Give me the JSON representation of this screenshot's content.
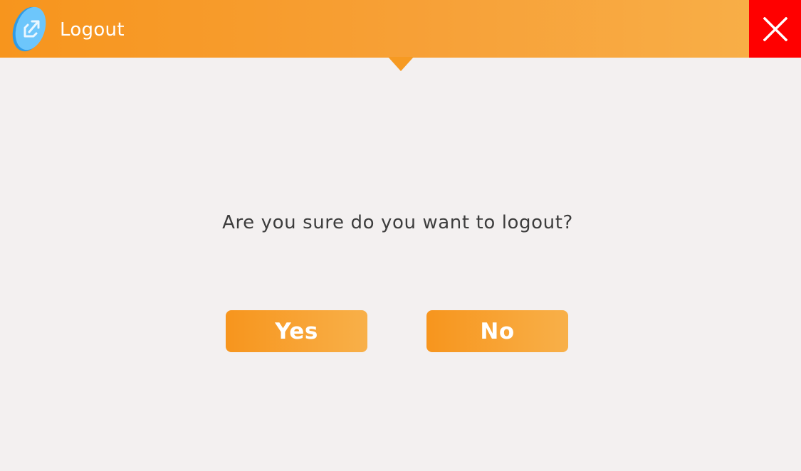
{
  "header": {
    "title": "Logout",
    "icon": "logout-arrow-icon",
    "close_icon": "close-icon",
    "background_color": "#f7951d",
    "close_background_color": "#ff0000"
  },
  "dialog": {
    "message": "Are you sure do you want to logout?",
    "yes_label": "Yes",
    "no_label": "No",
    "button_color": "#f7951d",
    "text_color": "#3d3d3d",
    "background_color": "#f3f0f0"
  }
}
